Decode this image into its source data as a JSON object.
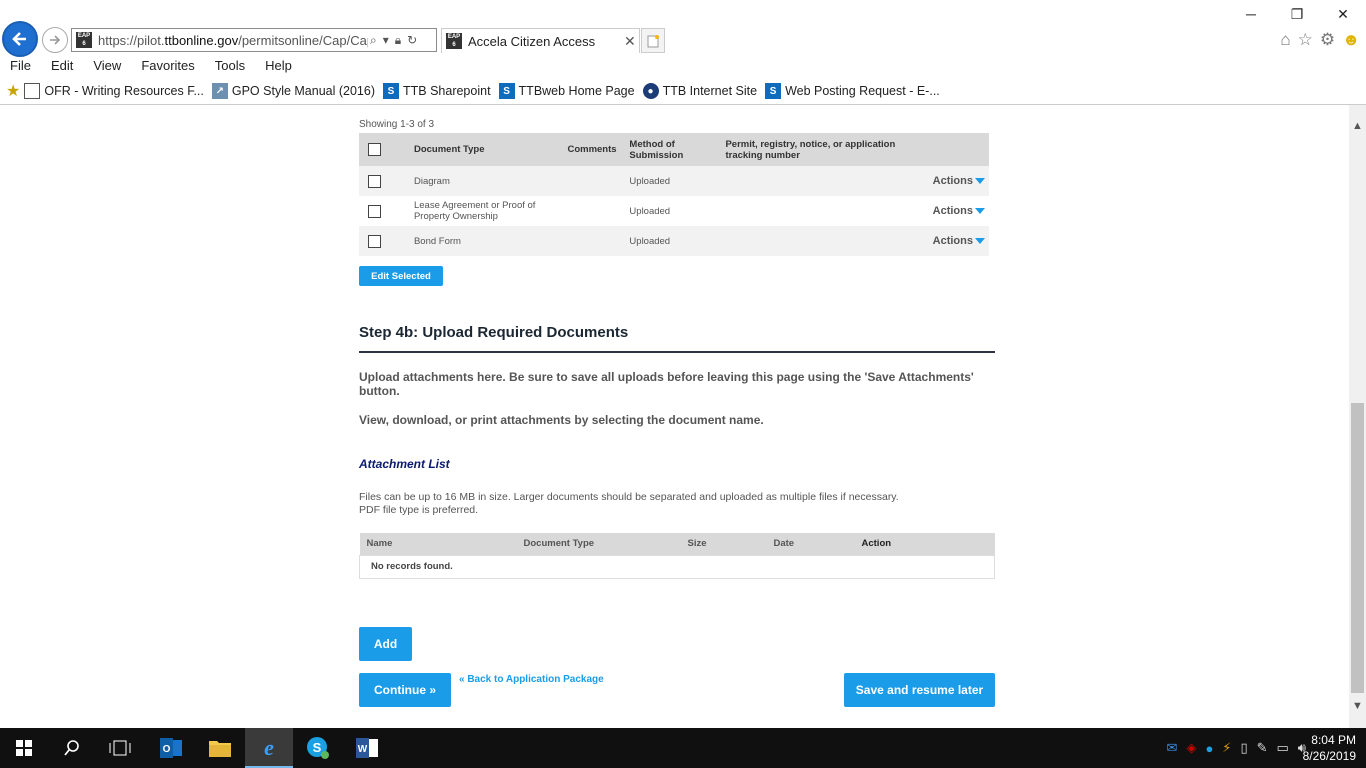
{
  "browser": {
    "url_prefix": "https://pilot.",
    "url_domain": "ttbonline.gov",
    "url_path": "/permitsonline/Cap/Cap",
    "site_badge": "EAP 6",
    "tab_title": "Accela Citizen Access",
    "menu": [
      "File",
      "Edit",
      "View",
      "Favorites",
      "Tools",
      "Help"
    ],
    "favorites": [
      "OFR - Writing Resources F...",
      "GPO Style Manual (2016)",
      "TTB Sharepoint",
      "TTBweb Home Page",
      "TTB Internet Site",
      "Web Posting Request - E-..."
    ]
  },
  "documents": {
    "showing": "Showing 1-3 of 3",
    "columns": [
      "Document Type",
      "Comments",
      "Method of Submission",
      "Permit, registry, notice, or application tracking number"
    ],
    "rows": [
      {
        "type": "Diagram",
        "comments": "",
        "method": "Uploaded",
        "tracking": "",
        "action": "Actions"
      },
      {
        "type": "Lease Agreement or Proof of Property Ownership",
        "comments": "",
        "method": "Uploaded",
        "tracking": "",
        "action": "Actions"
      },
      {
        "type": "Bond Form",
        "comments": "",
        "method": "Uploaded",
        "tracking": "",
        "action": "Actions"
      }
    ],
    "edit_selected": "Edit Selected"
  },
  "upload": {
    "title": "Step 4b: Upload Required Documents",
    "para1": "Upload attachments here. Be sure to save all uploads before leaving this page using the 'Save Attachments' button.",
    "para2": "View, download, or print attachments by selecting the document name.",
    "list_title": "Attachment List",
    "files_note_1": "Files can be up to 16 MB in size. Larger documents should be separated and uploaded as multiple files if necessary.",
    "files_note_2": "PDF file type is preferred.",
    "columns": [
      "Name",
      "Document Type",
      "Size",
      "Date",
      "Action"
    ],
    "empty": "No records found.",
    "add": "Add",
    "continue": "Continue »",
    "back_link": "« Back to Application Package",
    "save_resume": "Save and resume later"
  },
  "taskbar": {
    "time": "8:04 PM",
    "date": "8/26/2019"
  }
}
